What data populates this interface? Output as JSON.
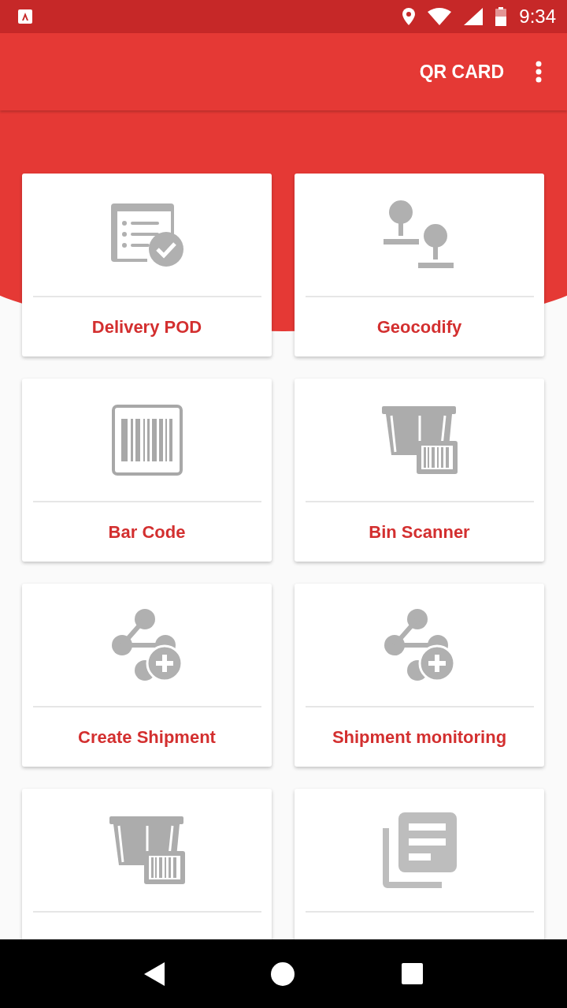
{
  "status_bar": {
    "time": "9:34"
  },
  "app_bar": {
    "action": "QR CARD"
  },
  "tiles": [
    {
      "kind": "pod",
      "label": "Delivery POD"
    },
    {
      "kind": "geocode",
      "label": "Geocodify"
    },
    {
      "kind": "barcode",
      "label": "Bar Code"
    },
    {
      "kind": "bin",
      "label": "Bin Scanner"
    },
    {
      "kind": "share",
      "label": "Create Shipment"
    },
    {
      "kind": "share",
      "label": "Shipment monitoring"
    },
    {
      "kind": "bin"
    },
    {
      "kind": "documents"
    }
  ]
}
